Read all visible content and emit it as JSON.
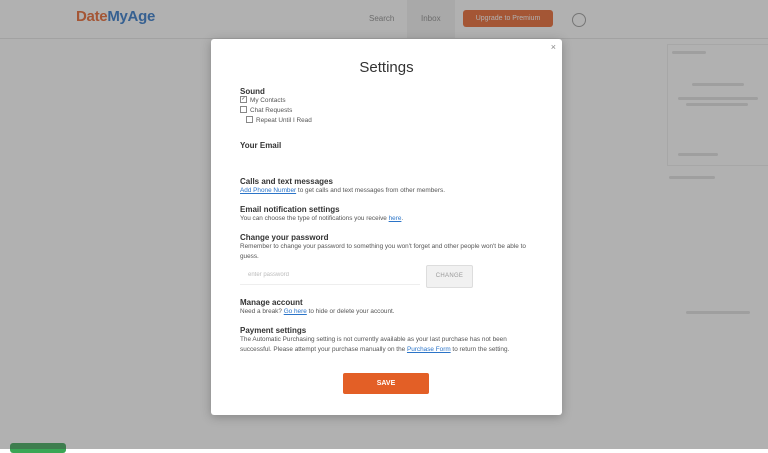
{
  "background": {
    "logo": {
      "part1": "Date",
      "part2": "MyAge"
    },
    "nav": {
      "link1": "Search",
      "link2": "Inbox",
      "cta": "Upgrade to Premium"
    },
    "colors": {
      "accent": "#e8622a",
      "brand_blue": "#2b74c8",
      "live": "#3aa655"
    }
  },
  "modal": {
    "title": "Settings",
    "close_label": "×",
    "sound": {
      "heading": "Sound",
      "options": [
        {
          "label": "My Contacts",
          "checked": true
        },
        {
          "label": "Chat Requests",
          "checked": false
        },
        {
          "label": "Repeat Until I Read",
          "checked": false
        }
      ]
    },
    "email": {
      "heading": "Your Email"
    },
    "calls": {
      "heading": "Calls and text messages",
      "link": "Add Phone Number",
      "text": " to get calls and text messages from other members."
    },
    "notifications": {
      "heading": "Email notification settings",
      "text": "You can choose the type of notifications you receive ",
      "link": "here",
      "suffix": "."
    },
    "password": {
      "heading": "Change your password",
      "text": "Remember to change your password to something you won't forget and other people won't be able to guess.",
      "placeholder": "enter password",
      "button": "CHANGE"
    },
    "account": {
      "heading": "Manage account",
      "text": "Need a break? ",
      "link": "Go here",
      "suffix": " to hide or delete your account."
    },
    "payment": {
      "heading": "Payment settings",
      "text": "The Automatic Purchasing setting is not currently available as your last purchase has not been successful. Please attempt your purchase manually on the ",
      "link": "Purchase Form",
      "suffix": " to return the setting."
    },
    "save_label": "SAVE"
  }
}
